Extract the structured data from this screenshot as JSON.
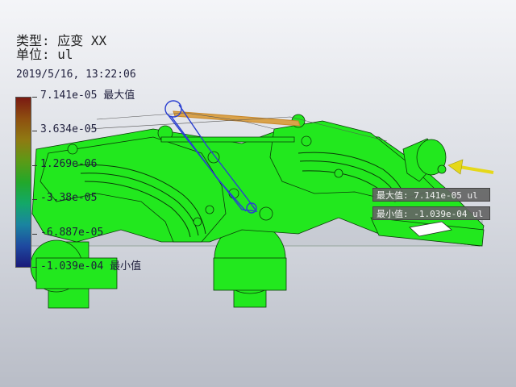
{
  "header": {
    "type_line": "类型: 应变 XX",
    "unit_line": "单位: ul",
    "timestamp": "2019/5/16, 13:22:06"
  },
  "legend": {
    "colors": [
      "#7a1a12",
      "#8e4f10",
      "#8f7a12",
      "#5c9a16",
      "#22a82a",
      "#13a868",
      "#1a84a0",
      "#1e4aa0",
      "#1a1a7a"
    ],
    "ticks": [
      {
        "label": "7.141e-05 最大值",
        "fraction": 0.0
      },
      {
        "label": "3.634e-05",
        "fraction": 0.2
      },
      {
        "label": "1.269e-06",
        "fraction": 0.4
      },
      {
        "label": "-3.38e-05",
        "fraction": 0.6
      },
      {
        "label": "-6.887e-05",
        "fraction": 0.8
      },
      {
        "label": "-1.039e-04 最小值",
        "fraction": 1.0
      }
    ]
  },
  "probes": {
    "max_label": "最大值: 7.141e-05 ul",
    "min_label": "最小值: -1.039e-04 ul"
  },
  "colors": {
    "model_fill": "#22e81e",
    "model_edge": "#0a3a08",
    "load_arrow": "#e5d81a",
    "link_blue": "#2a3fd0",
    "link_orange": "#c8872a"
  }
}
